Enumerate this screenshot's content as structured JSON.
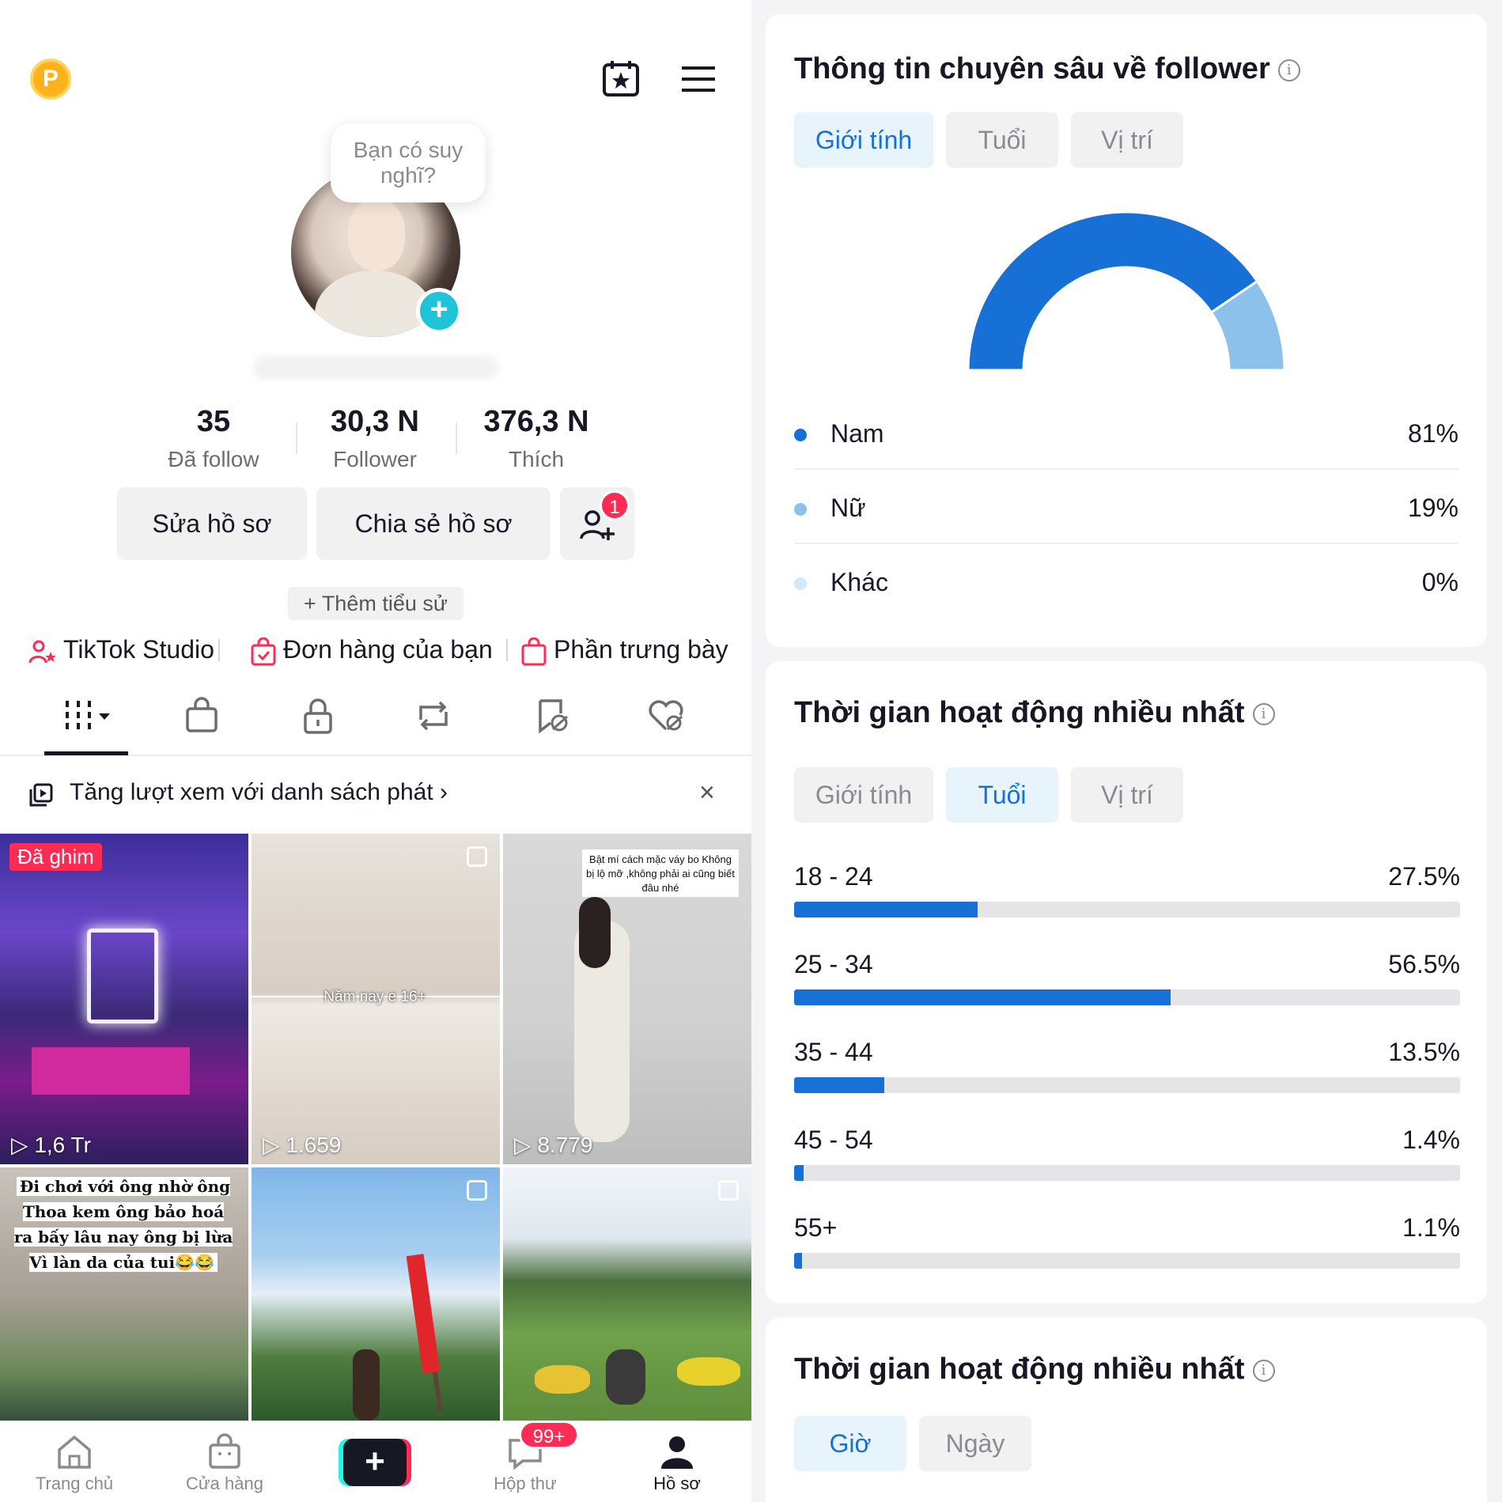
{
  "profile": {
    "coin_label": "P",
    "bubble_text": "Bạn có suy nghĩ?",
    "stats": [
      {
        "value": "35",
        "label": "Đã follow"
      },
      {
        "value": "30,3 N",
        "label": "Follower"
      },
      {
        "value": "376,3 N",
        "label": "Thích"
      }
    ],
    "buttons": {
      "edit": "Sửa hồ sơ",
      "share": "Chia sẻ hồ sơ",
      "add_friends_badge": "1"
    },
    "bio_button": "+ Thêm tiểu sử",
    "links": [
      {
        "label": "TikTok Studio",
        "icon": "creator-icon"
      },
      {
        "label": "Đơn hàng của bạn",
        "icon": "order-bag-icon"
      },
      {
        "label": "Phần trưng bày",
        "icon": "showcase-bag-icon"
      }
    ],
    "tabs": [
      "videos-grid-icon",
      "shop-bag-icon",
      "lock-icon",
      "repost-icon",
      "favorites-icon",
      "liked-icon"
    ],
    "playlist_banner": "Tăng lượt xem với danh sách phát ›",
    "playlist_close": "×"
  },
  "grid": {
    "pinned_label": "Đã ghim",
    "items": [
      {
        "views": "1,6 Tr",
        "pinned": true
      },
      {
        "views": "1.659",
        "caption": "Năm nay e 16+"
      },
      {
        "views": "8.779",
        "caption": "Bật mí cách mặc váy bo Không bị lộ mỡ ,không phải ai cũng biết đâu nhé"
      },
      {
        "caption": "Đi chơi với ông nhờ ông Thoa kem ông bảo hoá ra bấy lâu nay ông bị lừa Vì làn da của tui😂😂"
      },
      {},
      {}
    ]
  },
  "bottom_nav": {
    "items": [
      {
        "label": "Trang chủ",
        "icon": "home-icon"
      },
      {
        "label": "Cửa hàng",
        "icon": "shop-icon"
      },
      {
        "label": "+",
        "icon": "create-plus-icon"
      },
      {
        "label": "Hộp thư",
        "icon": "inbox-icon"
      },
      {
        "label": "Hồ sơ",
        "icon": "profile-icon"
      }
    ],
    "inbox_badge": "99+"
  },
  "insights": {
    "card1": {
      "title": "Thông tin chuyên sâu về follower",
      "segments": [
        "Giới tính",
        "Tuổi",
        "Vị trí"
      ],
      "active_segment": 0,
      "gender": [
        {
          "name": "Nam",
          "value": "81%",
          "color": "#1670d6",
          "fraction": 0.81
        },
        {
          "name": "Nữ",
          "value": "19%",
          "color": "#8cc1ec",
          "fraction": 0.19
        },
        {
          "name": "Khác",
          "value": "0%",
          "color": "#d3e9f8",
          "fraction": 0.0
        }
      ]
    },
    "card2": {
      "title": "Thời gian hoạt động nhiều nhất",
      "segments": [
        "Giới tính",
        "Tuổi",
        "Vị trí"
      ],
      "active_segment": 1,
      "ages": [
        {
          "label": "18 - 24",
          "value": "27.5%",
          "pct": 27.5
        },
        {
          "label": "25 - 34",
          "value": "56.5%",
          "pct": 56.5
        },
        {
          "label": "35 - 44",
          "value": "13.5%",
          "pct": 13.5
        },
        {
          "label": "45 - 54",
          "value": "1.4%",
          "pct": 1.4
        },
        {
          "label": "55+",
          "value": "1.1%",
          "pct": 1.1
        }
      ]
    },
    "card3": {
      "title": "Thời gian hoạt động nhiều nhất",
      "segments": [
        "Giờ",
        "Ngày"
      ],
      "active_segment": 0
    },
    "colors": {
      "accent": "#1670d6",
      "light": "#8cc1ec",
      "tab_active_bg": "#e7f4fb"
    }
  }
}
